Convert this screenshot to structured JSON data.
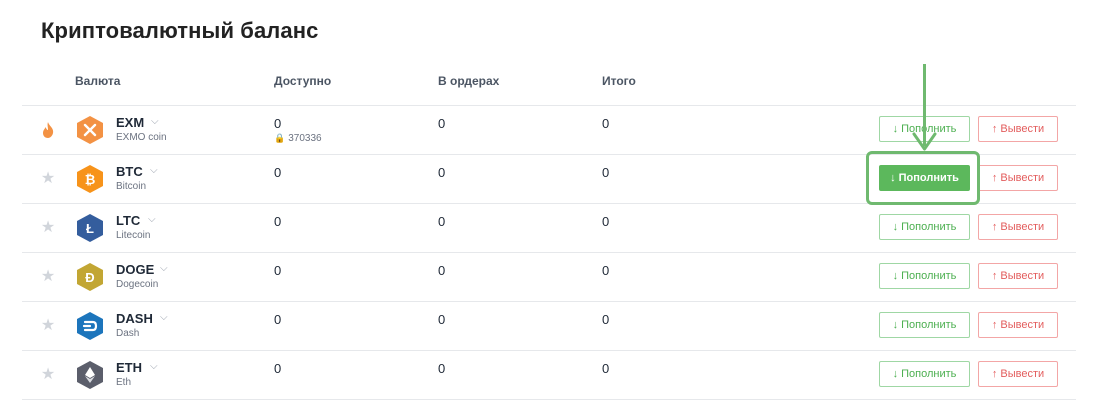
{
  "page": {
    "title": "Криптовалютный баланс"
  },
  "table": {
    "headers": {
      "currency": "Валюта",
      "available": "Доступно",
      "orders": "В ордерах",
      "total": "Итого"
    },
    "rows": [
      {
        "code": "EXM",
        "name": "EXMO coin",
        "available": "0",
        "locked": "370336",
        "orders": "0",
        "total": "0",
        "icon": "exmo-icon",
        "color": "#f39244",
        "favorite_icon": "fire-icon"
      },
      {
        "code": "BTC",
        "name": "Bitcoin",
        "available": "0",
        "orders": "0",
        "total": "0",
        "icon": "bitcoin-icon",
        "color": "#f7931a",
        "favorite_icon": "star-icon"
      },
      {
        "code": "LTC",
        "name": "Litecoin",
        "available": "0",
        "orders": "0",
        "total": "0",
        "icon": "litecoin-icon",
        "color": "#345d9d",
        "favorite_icon": "star-icon"
      },
      {
        "code": "DOGE",
        "name": "Dogecoin",
        "available": "0",
        "orders": "0",
        "total": "0",
        "icon": "dogecoin-icon",
        "color": "#c2a633",
        "favorite_icon": "star-icon"
      },
      {
        "code": "DASH",
        "name": "Dash",
        "available": "0",
        "orders": "0",
        "total": "0",
        "icon": "dash-icon",
        "color": "#1c75bc",
        "favorite_icon": "star-icon"
      },
      {
        "code": "ETH",
        "name": "Eth",
        "available": "0",
        "orders": "0",
        "total": "0",
        "icon": "ethereum-icon",
        "color": "#5b5e6b",
        "favorite_icon": "star-icon"
      }
    ]
  },
  "actions": {
    "deposit_label": "↓ Пополнить",
    "withdraw_label": "↑ Вывести"
  },
  "colors": {
    "deposit": "#5cb85c",
    "withdraw": "#e35d5d",
    "highlight": "#6fb96f"
  }
}
